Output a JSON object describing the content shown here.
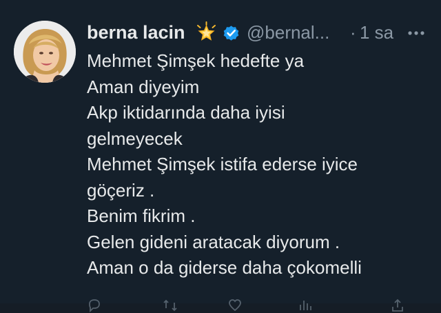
{
  "tweet": {
    "author": {
      "name": "berna lacin",
      "handle": "@bernal...",
      "avatar_icon": "avatar-photo",
      "name_badge_icon": "glowing-star-icon",
      "verified_icon": "verified-badge-icon",
      "verified_color": "#1d9bf0"
    },
    "separator": "·",
    "time": "1 sa",
    "more_icon": "more-horizontal-icon",
    "lines": [
      "Mehmet Şimşek hedefte ya",
      "Aman diyeyim",
      "Akp iktidarında daha iyisi",
      "gelmeyecek",
      "Mehmet Şimşek istifa ederse iyice",
      "göçeriz .",
      "Benim fikrim .",
      "Gelen gideni aratacak diyorum .",
      "Aman o da giderse daha çokomelli"
    ],
    "actions": [
      {
        "name": "reply",
        "icon": "reply-icon"
      },
      {
        "name": "retweet",
        "icon": "retweet-icon"
      },
      {
        "name": "like",
        "icon": "heart-icon"
      },
      {
        "name": "views",
        "icon": "views-icon"
      },
      {
        "name": "share",
        "icon": "share-icon"
      }
    ]
  },
  "colors": {
    "background": "#15202b",
    "text": "#e7e9ea",
    "secondary": "#8b98a5",
    "accent": "#1d9bf0"
  }
}
